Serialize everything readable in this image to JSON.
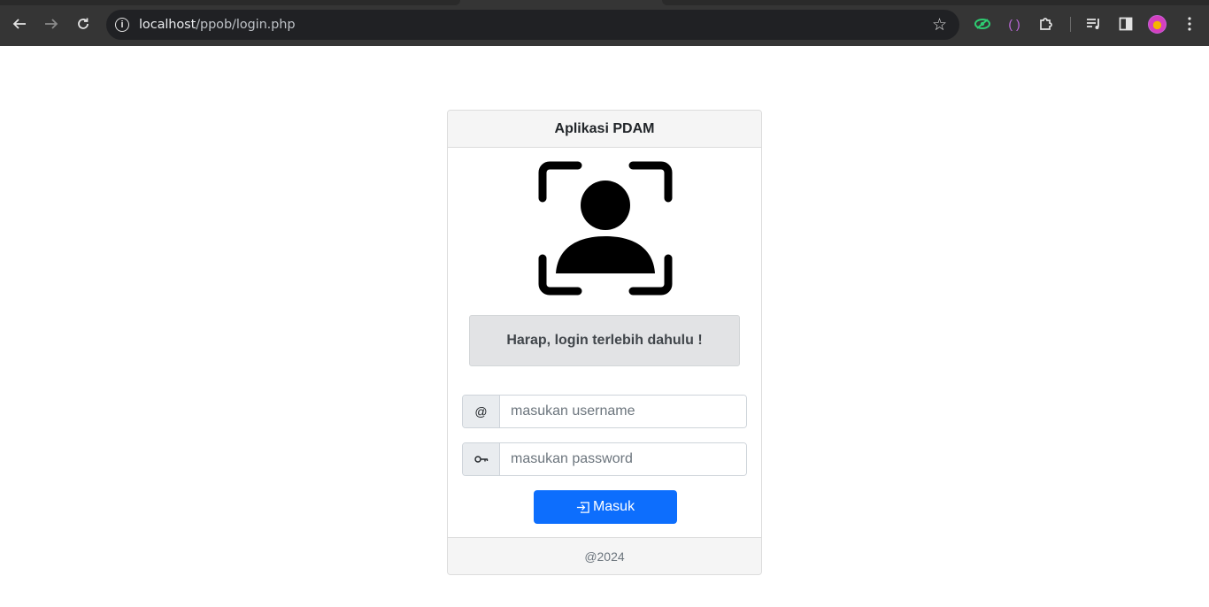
{
  "browser": {
    "url_host": "localhost",
    "url_path": "/ppob/login.php"
  },
  "card": {
    "title": "Aplikasi PDAM",
    "notice": "Harap, login terlebih dahulu !",
    "username": {
      "addon": "@",
      "placeholder": "masukan username",
      "value": ""
    },
    "password": {
      "addon_icon": "key-icon",
      "placeholder": "masukan password",
      "value": ""
    },
    "submit_label": "Masuk",
    "submit_icon": "box-arrow-in-right-icon",
    "footer": "@2024"
  },
  "colors": {
    "primary": "#0d6efd",
    "notice_bg": "#e2e3e5",
    "chrome_bg": "#353535"
  }
}
